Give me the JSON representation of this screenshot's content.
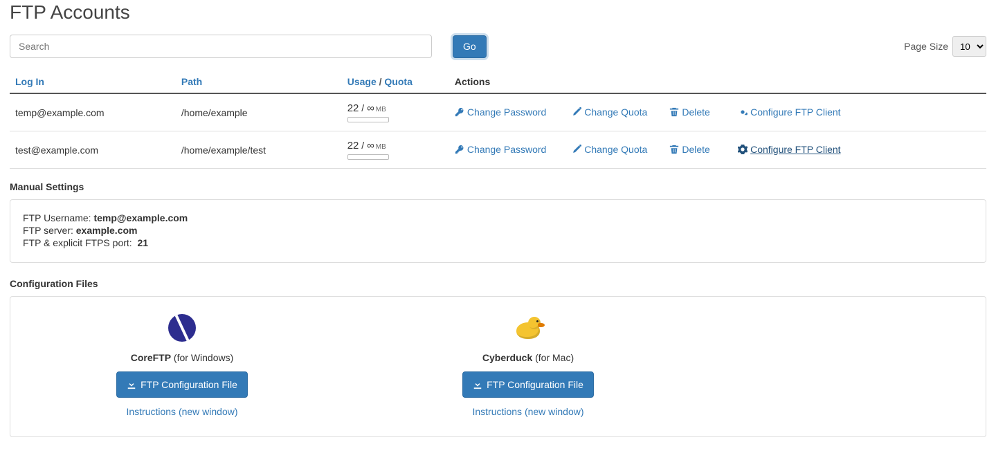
{
  "page_title": "FTP Accounts",
  "search": {
    "placeholder": "Search",
    "go_label": "Go"
  },
  "page_size": {
    "label": "Page Size",
    "value": "10"
  },
  "table": {
    "headers": {
      "login": "Log In",
      "path": "Path",
      "usage": "Usage",
      "quota": "Quota",
      "actions": "Actions"
    },
    "action_labels": {
      "change_password": "Change Password",
      "change_quota": "Change Quota",
      "delete": "Delete",
      "configure": "Configure FTP Client"
    },
    "rows": [
      {
        "login": "temp@example.com",
        "path": "/home/example",
        "usage": "22",
        "quota": "∞",
        "unit": "MB"
      },
      {
        "login": "test@example.com",
        "path": "/home/example/test",
        "usage": "22",
        "quota": "∞",
        "unit": "MB"
      }
    ]
  },
  "manual": {
    "heading": "Manual Settings",
    "username_label": "FTP Username:",
    "username": "temp@example.com",
    "server_label": "FTP server:",
    "server": "example.com",
    "port_label": "FTP & explicit FTPS port:",
    "port": "21"
  },
  "config": {
    "heading": "Configuration Files",
    "coreftp": {
      "name": "CoreFTP",
      "os": " (for Windows)"
    },
    "cyberduck": {
      "name": "Cyberduck",
      "os": " (for Mac)"
    },
    "download_label": "FTP Configuration File",
    "instructions_label": "Instructions (new window)"
  }
}
